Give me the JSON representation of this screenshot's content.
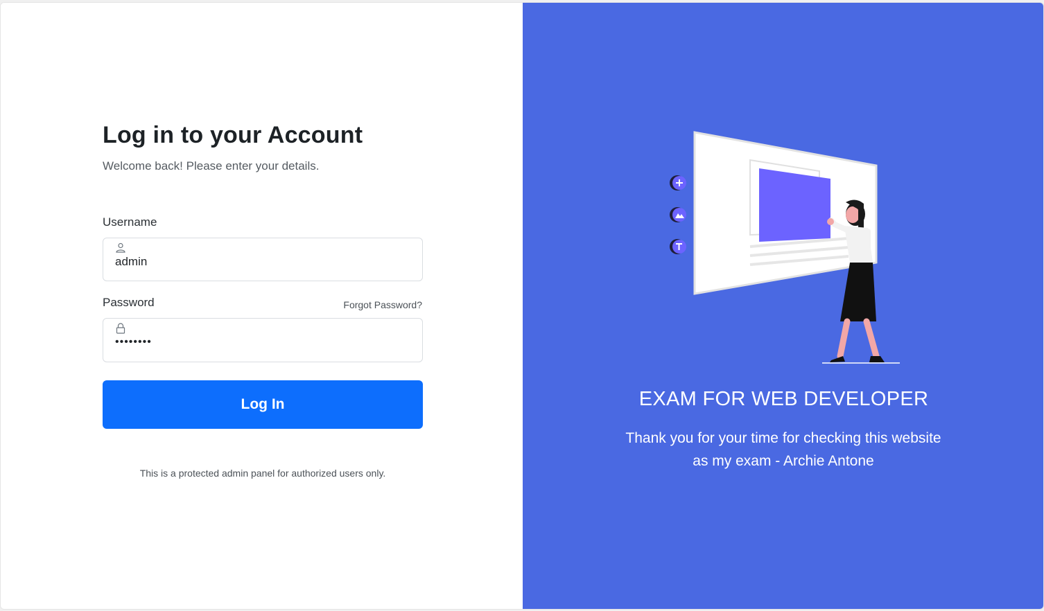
{
  "login": {
    "title": "Log in to your Account",
    "subtitle": "Welcome back! Please enter your details.",
    "username_label": "Username",
    "username_value": "admin",
    "password_label": "Password",
    "password_value": "password",
    "forgot_label": "Forgot Password?",
    "button_label": "Log In",
    "notice": "This is a protected admin panel for authorized users only."
  },
  "promo": {
    "heading": "EXAM FOR WEB DEVELOPER",
    "description": "Thank you for your time for checking this website as my exam - Archie Antone"
  },
  "colors": {
    "accent_panel": "#4a69e2",
    "button": "#0d6efd",
    "illustration_purple": "#6c63ff"
  },
  "icons": {
    "username": "user-icon",
    "password": "lock-icon"
  }
}
